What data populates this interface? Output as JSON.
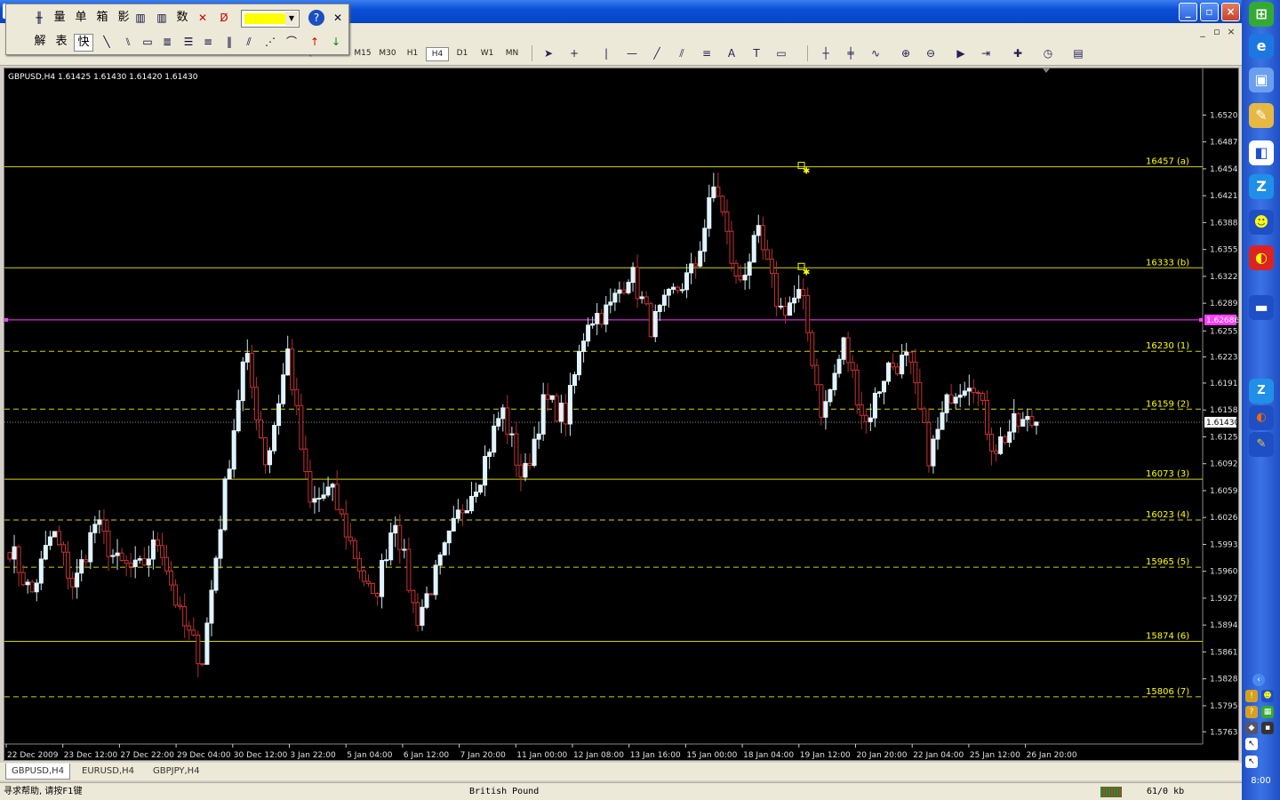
{
  "window": {
    "icon": "z-app-icon"
  },
  "floatbar": {
    "row1": [
      "量",
      "单",
      "箱",
      "影",
      "数"
    ],
    "row2": [
      "解",
      "表",
      "快"
    ]
  },
  "menubar": {
    "mdi": [
      "_",
      "▫",
      "×"
    ]
  },
  "toolbar": {
    "timeframes": [
      "M15",
      "M30",
      "H1",
      "H4",
      "D1",
      "W1",
      "MN"
    ],
    "active_timeframe": "H4"
  },
  "chart": {
    "header": "GBPUSD,H4  1.61425 1.61430 1.61420 1.61430",
    "current_price_label": "1.61430",
    "pink_line_label": "1.62686"
  },
  "chart_data": {
    "type": "candlestick",
    "symbol": "GBPUSD",
    "timeframe": "H4",
    "ohlc_header": [
      1.61425,
      1.6143,
      1.6142,
      1.6143
    ],
    "ylim": [
      1.5748,
      1.6575
    ],
    "yticks": [
      "1.65200",
      "1.64870",
      "1.64540",
      "1.64210",
      "1.63880",
      "1.63550",
      "1.63220",
      "1.62890",
      "1.62550",
      "1.62230",
      "1.61910",
      "1.61580",
      "1.61250",
      "1.60920",
      "1.60590",
      "1.60260",
      "1.59930",
      "1.59600",
      "1.59270",
      "1.58940",
      "1.58610",
      "1.58280",
      "1.57950",
      "1.57630"
    ],
    "xticks": [
      "22 Dec 2009",
      "23 Dec 12:00",
      "27 Dec 22:00",
      "29 Dec 04:00",
      "30 Dec 12:00",
      "3 Jan 22:00",
      "5 Jan 04:00",
      "6 Jan 12:00",
      "7 Jan 20:00",
      "11 Jan 00:00",
      "12 Jan 08:00",
      "13 Jan 16:00",
      "15 Jan 00:00",
      "18 Jan 04:00",
      "19 Jan 12:00",
      "20 Jan 20:00",
      "22 Jan 04:00",
      "25 Jan 12:00",
      "26 Jan 20:00"
    ],
    "current_price": 1.6143,
    "horizontal_line": 1.62686,
    "levels": [
      {
        "label": "16457 (a)",
        "price": 1.64565,
        "style": "solid"
      },
      {
        "label": "16333 (b)",
        "price": 1.63325,
        "style": "solid"
      },
      {
        "label": "16230 (1)",
        "price": 1.623,
        "style": "dashed"
      },
      {
        "label": "16159 (2)",
        "price": 1.6159,
        "style": "dashed"
      },
      {
        "label": "16073 (3)",
        "price": 1.6073,
        "style": "solid"
      },
      {
        "label": "16023 (4)",
        "price": 1.6023,
        "style": "dashed"
      },
      {
        "label": "15965 (5)",
        "price": 1.5965,
        "style": "dashed"
      },
      {
        "label": "15874 (6)",
        "price": 1.5874,
        "style": "solid"
      },
      {
        "label": "15806 (7)",
        "price": 1.5806,
        "style": "dashed"
      }
    ],
    "anchors": [
      "1.6457",
      "1.6333"
    ],
    "waypoints": [
      1.599,
      1.593,
      1.601,
      1.594,
      1.602,
      1.597,
      1.596,
      1.6,
      1.59,
      1.585,
      1.605,
      1.623,
      1.609,
      1.623,
      1.604,
      1.606,
      1.599,
      1.592,
      1.603,
      1.59,
      1.596,
      1.603,
      1.608,
      1.616,
      1.607,
      1.617,
      1.615,
      1.627,
      1.628,
      1.633,
      1.626,
      1.63,
      1.633,
      1.644,
      1.631,
      1.637,
      1.628,
      1.63,
      1.615,
      1.624,
      1.614,
      1.621,
      1.622,
      1.61,
      1.618,
      1.62,
      1.611,
      1.614,
      1.6143
    ]
  },
  "tabs": [
    {
      "label": "GBPUSD,H4",
      "active": true
    },
    {
      "label": "EURUSD,H4",
      "active": false
    },
    {
      "label": "GBPJPY,H4",
      "active": false
    }
  ],
  "status": {
    "help": "寻求帮助, 请按F1键",
    "profile": "British Pound",
    "connection": "61/0 kb"
  },
  "tray": {
    "clock": "8:00"
  }
}
